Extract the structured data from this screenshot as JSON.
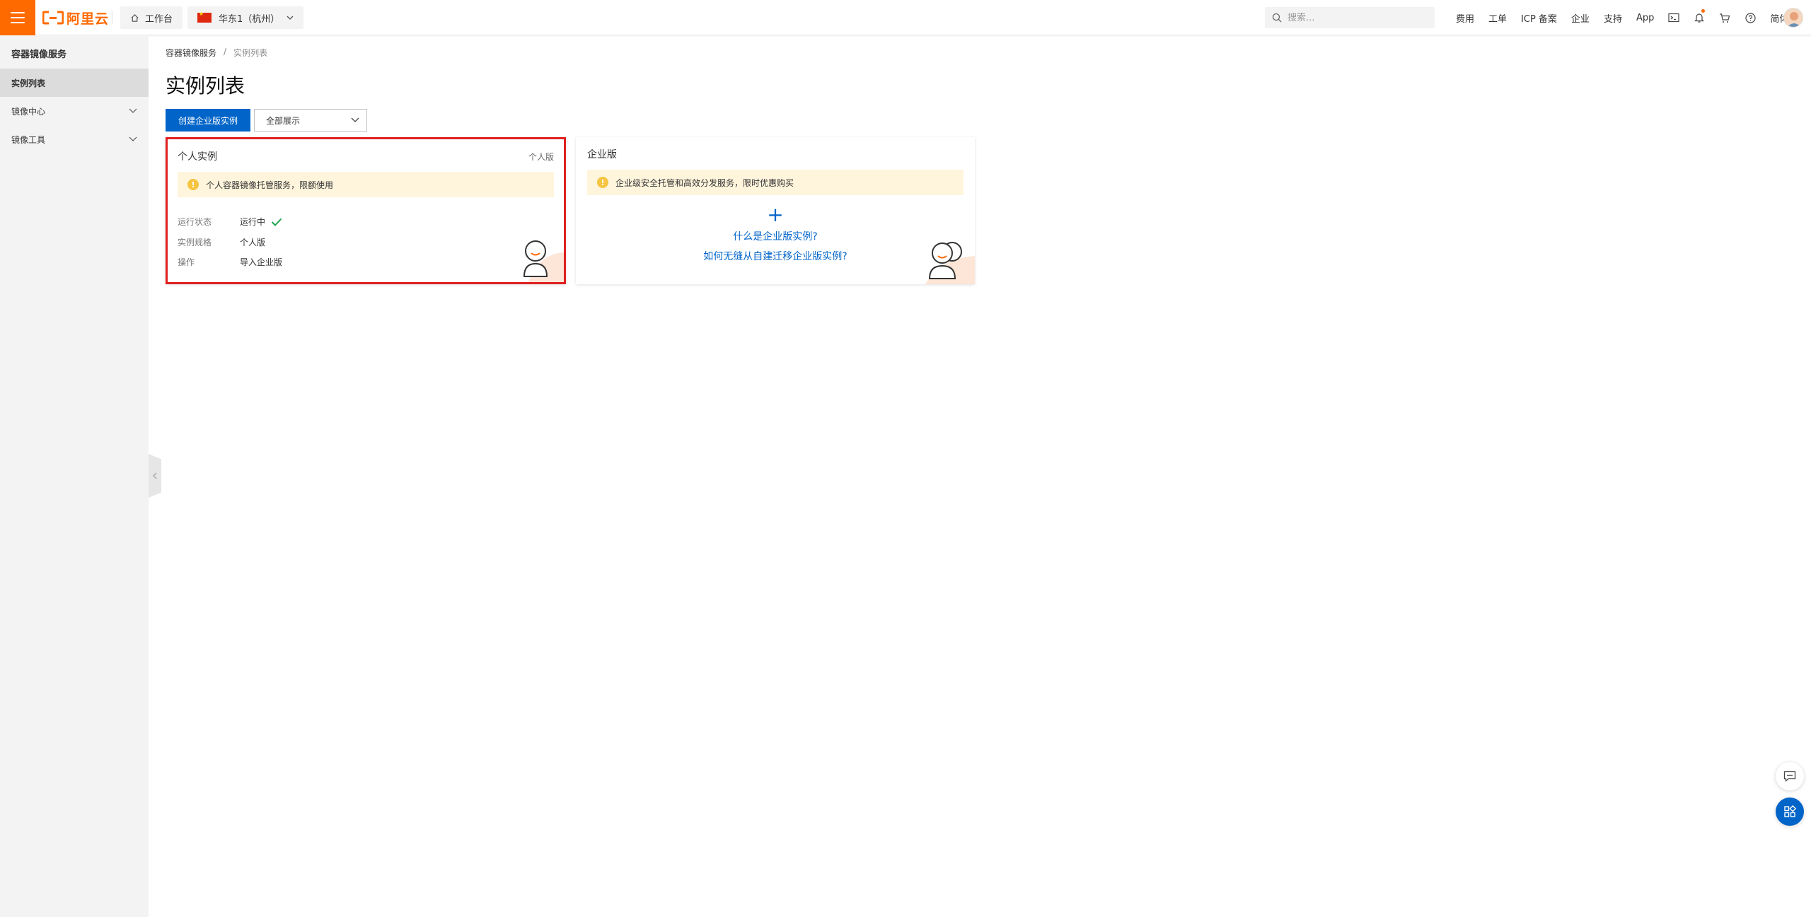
{
  "header": {
    "logo_text": "阿里云",
    "workbench_label": "工作台",
    "region_label": "华东1（杭州）",
    "search_placeholder": "搜索...",
    "nav": [
      "费用",
      "工单",
      "ICP 备案",
      "企业",
      "支持",
      "App"
    ],
    "language": "简体"
  },
  "sidebar": {
    "title": "容器镜像服务",
    "items": [
      {
        "label": "实例列表",
        "active": true
      },
      {
        "label": "镜像中心"
      },
      {
        "label": "镜像工具"
      }
    ]
  },
  "breadcrumb": {
    "root": "容器镜像服务",
    "separator": "/",
    "current": "实例列表"
  },
  "page": {
    "title": "实例列表",
    "create_button": "创建企业版实例",
    "filter_value": "全部展示"
  },
  "personal_card": {
    "title": "个人实例",
    "tag": "个人版",
    "notice": "个人容器镜像托管服务，限额使用",
    "rows": [
      {
        "label": "运行状态",
        "value": "运行中"
      },
      {
        "label": "实例规格",
        "value": "个人版"
      },
      {
        "label": "操作",
        "value": "导入企业版"
      }
    ]
  },
  "enterprise_card": {
    "title": "企业版",
    "notice": "企业级安全托管和高效分发服务，限时优惠购买",
    "link_what": "什么是企业版实例?",
    "link_migrate": "如何无缝从自建迁移企业版实例?"
  },
  "colors": {
    "brand": "#ff6a00",
    "primary": "#0064c8",
    "highlight_border": "#e02020",
    "notice_bg": "#fff5dc",
    "success": "#1aa34a"
  }
}
